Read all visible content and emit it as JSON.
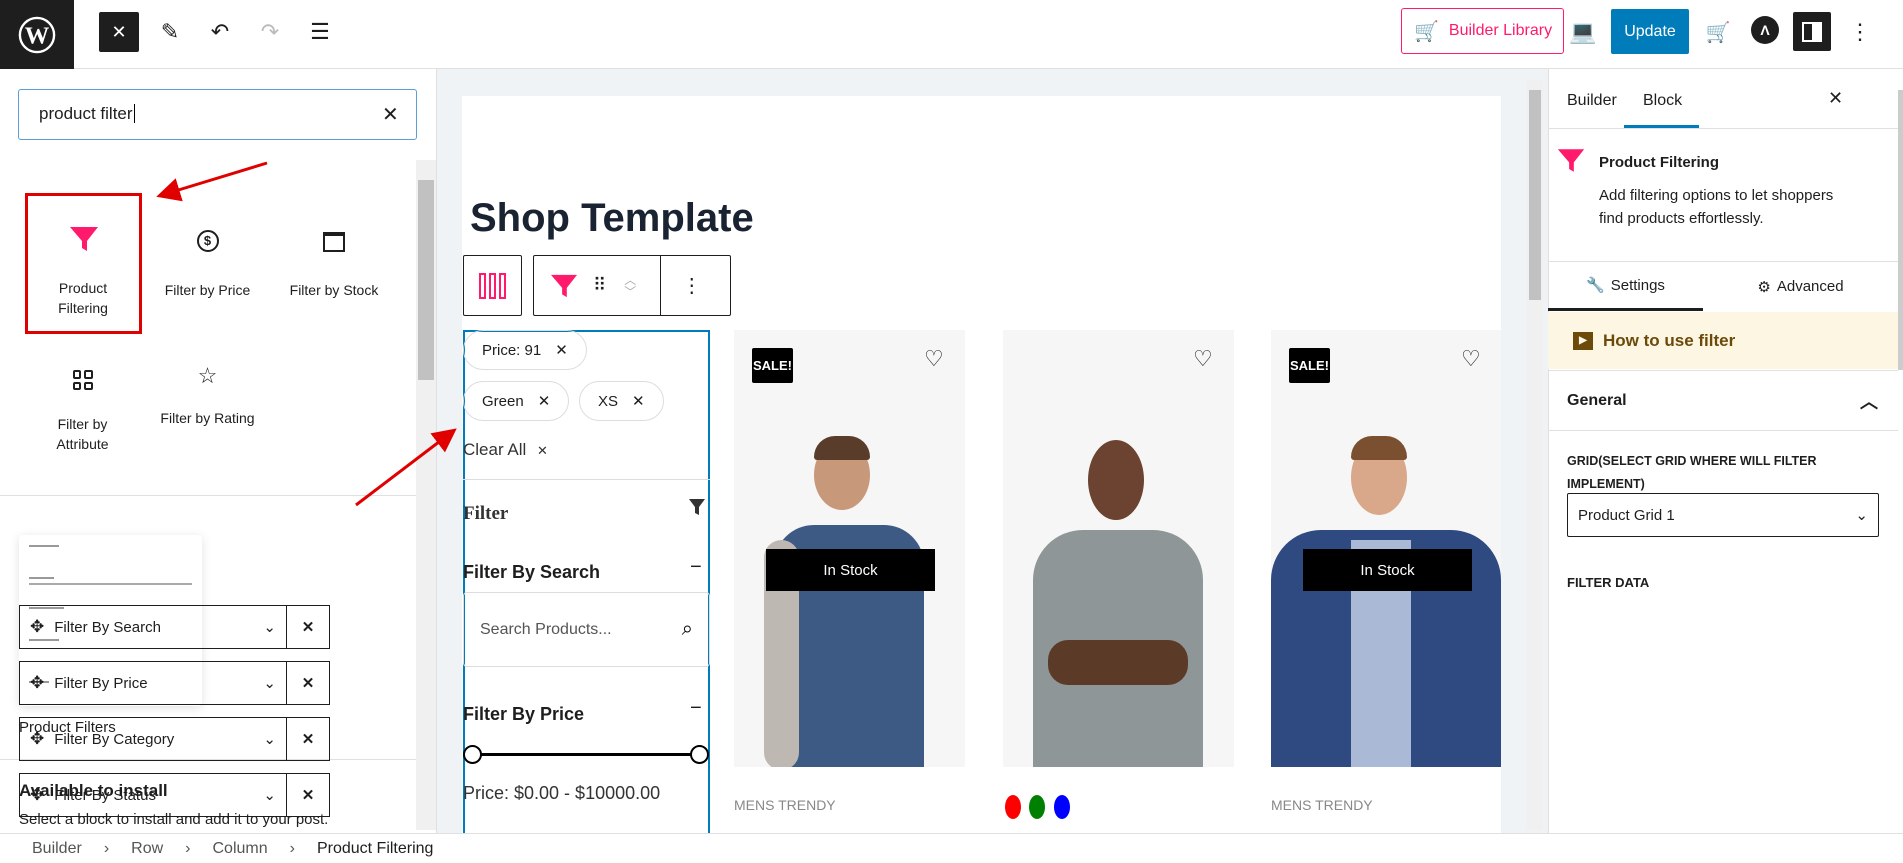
{
  "topbar": {
    "builder_library": "Builder Library",
    "update": "Update"
  },
  "inserter": {
    "search_value": "product filter",
    "blocks": [
      {
        "label": "Product Filtering",
        "icon": "funnel-icon"
      },
      {
        "label": "Filter by Price",
        "icon": "dollar-circle-icon"
      },
      {
        "label": "Filter by Stock",
        "icon": "archive-box-icon"
      },
      {
        "label": "Filter by Attribute",
        "icon": "grid-icon"
      },
      {
        "label": "Filter by Rating",
        "icon": "star-icon"
      }
    ],
    "pattern_label": "Product Filters",
    "install_title": "Available to install",
    "install_desc": "Select a block to install and add it to your post."
  },
  "canvas": {
    "page_title": "Shop Template",
    "chips": [
      "Price: 91",
      "Green",
      "XS"
    ],
    "clear_all": "Clear All",
    "filter_heading": "Filter",
    "filter_by_search": "Filter By Search",
    "search_placeholder": "Search Products...",
    "filter_by_price": "Filter By Price",
    "price_range": "Price: $0.00 - $10000.00",
    "products": [
      {
        "sale": "SALE!",
        "stock": "In Stock",
        "category": "MENS TRENDY"
      },
      {
        "colors": [
          "#ff0000",
          "#008000",
          "#0000ff"
        ]
      },
      {
        "sale": "SALE!",
        "stock": "In Stock",
        "category": "MENS TRENDY"
      }
    ]
  },
  "sidebar": {
    "tabs": [
      "Builder",
      "Block"
    ],
    "active_tab": "Block",
    "block_title": "Product Filtering",
    "block_desc": "Add filtering options to let shoppers find products effortlessly.",
    "subtabs": [
      "Settings",
      "Advanced"
    ],
    "how_to": "How to use filter",
    "general": "General",
    "grid_label": "GRID(SELECT GRID WHERE WILL FILTER IMPLEMENT)",
    "grid_value": "Product Grid 1",
    "filter_data_label": "FILTER DATA",
    "filter_rows": [
      "Filter By Search",
      "Filter By Price",
      "Filter By Category",
      "Filter By Status"
    ]
  },
  "breadcrumb": [
    "Builder",
    "Row",
    "Column",
    "Product Filtering"
  ],
  "colors": {
    "accent": "#ff1a6c",
    "wp_blue": "#007cba",
    "annotation": "#e00000"
  }
}
